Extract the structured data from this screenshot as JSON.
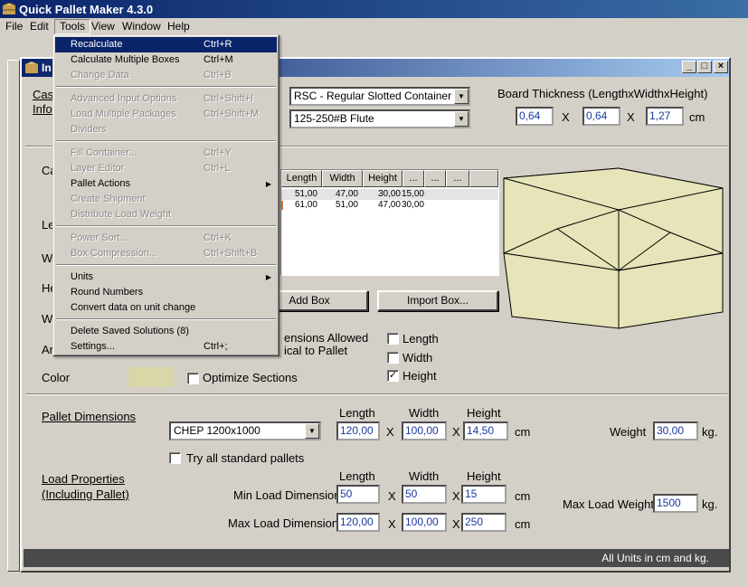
{
  "app": {
    "title": "Quick Pallet Maker 4.3.0"
  },
  "menubar": {
    "items": [
      "File",
      "Edit",
      "Tools",
      "View",
      "Window",
      "Help"
    ]
  },
  "child_window": {
    "title_partial": "In"
  },
  "tools_menu": {
    "items": [
      {
        "label": "Recalculate",
        "shortcut": "Ctrl+R",
        "enabled": true,
        "highlighted": true
      },
      {
        "label": "Calculate Multiple Boxes",
        "shortcut": "Ctrl+M",
        "enabled": true
      },
      {
        "label": "Change Data",
        "shortcut": "Ctrl+B",
        "enabled": false
      },
      {
        "separator": true
      },
      {
        "label": "Advanced Input Options",
        "shortcut": "Ctrl+Shift+I",
        "enabled": false
      },
      {
        "label": "Load Multiple Packages",
        "shortcut": "Ctrl+Shift+M",
        "enabled": false
      },
      {
        "label": "Dividers",
        "shortcut": "",
        "enabled": false
      },
      {
        "separator": true
      },
      {
        "label": "Fill Container...",
        "shortcut": "Ctrl+Y",
        "enabled": false
      },
      {
        "label": "Layer Editor",
        "shortcut": "Ctrl+L",
        "enabled": false
      },
      {
        "label": "Pallet Actions",
        "shortcut": "",
        "enabled": true,
        "submenu": true
      },
      {
        "label": "Create Shipment",
        "shortcut": "",
        "enabled": false
      },
      {
        "label": "Distribute Load Weight",
        "shortcut": "",
        "enabled": false
      },
      {
        "separator": true
      },
      {
        "label": "Power Sort...",
        "shortcut": "Ctrl+K",
        "enabled": false
      },
      {
        "label": "Box Compression...",
        "shortcut": "Ctrl+Shift+B",
        "enabled": false
      },
      {
        "separator": true
      },
      {
        "label": "Units",
        "shortcut": "",
        "enabled": true,
        "submenu": true
      },
      {
        "label": "Round Numbers",
        "shortcut": "",
        "enabled": true
      },
      {
        "label": "Convert data on unit change",
        "shortcut": "",
        "enabled": true
      },
      {
        "separator": true
      },
      {
        "label": "Delete Saved Solutions (8)",
        "shortcut": "",
        "enabled": true
      },
      {
        "label": "Settings...",
        "shortcut": "Ctrl+;",
        "enabled": true
      }
    ]
  },
  "case_info": {
    "heading_line1": "Cas",
    "heading_line2": "Info",
    "style_select": "RSC - Regular Slotted Container",
    "flute_select": "125-250#B Flute",
    "board_thickness_label": "Board Thickness (LengthxWidthxHeight)",
    "board_length": "0,64",
    "board_width": "0,64",
    "board_height": "1,27",
    "board_unit": "cm",
    "x_sep": "X"
  },
  "case_section": {
    "labels_partial": [
      "Ca",
      "Le",
      "W",
      "He",
      "W",
      "Ar"
    ],
    "color_label": "Color",
    "color_swatch": "#d9d6a8",
    "optimize_label": "Optimize Sections",
    "orientation_text_line1": "ensions Allowed",
    "orientation_text_line2": "ical to Pallet",
    "orientation_checks": [
      {
        "label": "Length",
        "checked": false
      },
      {
        "label": "Width",
        "checked": false
      },
      {
        "label": "Height",
        "checked": true
      }
    ],
    "add_box_label": "Add Box",
    "import_box_label": "Import Box...",
    "box_fill_color": "#e6e4b8"
  },
  "boxes_table": {
    "columns": [
      "Length",
      "Width",
      "Height",
      "...",
      "...",
      "..."
    ],
    "rows": [
      [
        "51,00",
        "47,00",
        "30,00",
        "15,00"
      ],
      [
        "61,00",
        "51,00",
        "47,00",
        "30,00"
      ]
    ]
  },
  "pallet": {
    "heading": "Pallet Dimensions",
    "select": "CHEP 1200x1000",
    "length_label": "Length",
    "width_label": "Width",
    "height_label": "Height",
    "length": "120,00",
    "width": "100,00",
    "height": "14,50",
    "unit": "cm",
    "weight_label": "Weight",
    "weight": "30,00",
    "weight_unit": "kg.",
    "try_all_label": "Try all standard pallets"
  },
  "load": {
    "heading_line1": "Load Properties",
    "heading_line2": "(Including Pallet)",
    "length_label": "Length",
    "width_label": "Width",
    "height_label": "Height",
    "min_label": "Min Load Dimensions",
    "min_length": "50",
    "min_width": "50",
    "min_height": "15",
    "max_label": "Max Load Dimensions",
    "max_length": "120,00",
    "max_width": "100,00",
    "max_height": "250",
    "unit": "cm",
    "max_weight_label": "Max Load Weight",
    "max_weight": "1500",
    "max_weight_unit": "kg."
  },
  "status": {
    "text": "All Units in cm and kg."
  },
  "colors": {
    "title_blue": "#0a246a",
    "face": "#d4d0c8",
    "input_text": "#1a3aa0"
  }
}
